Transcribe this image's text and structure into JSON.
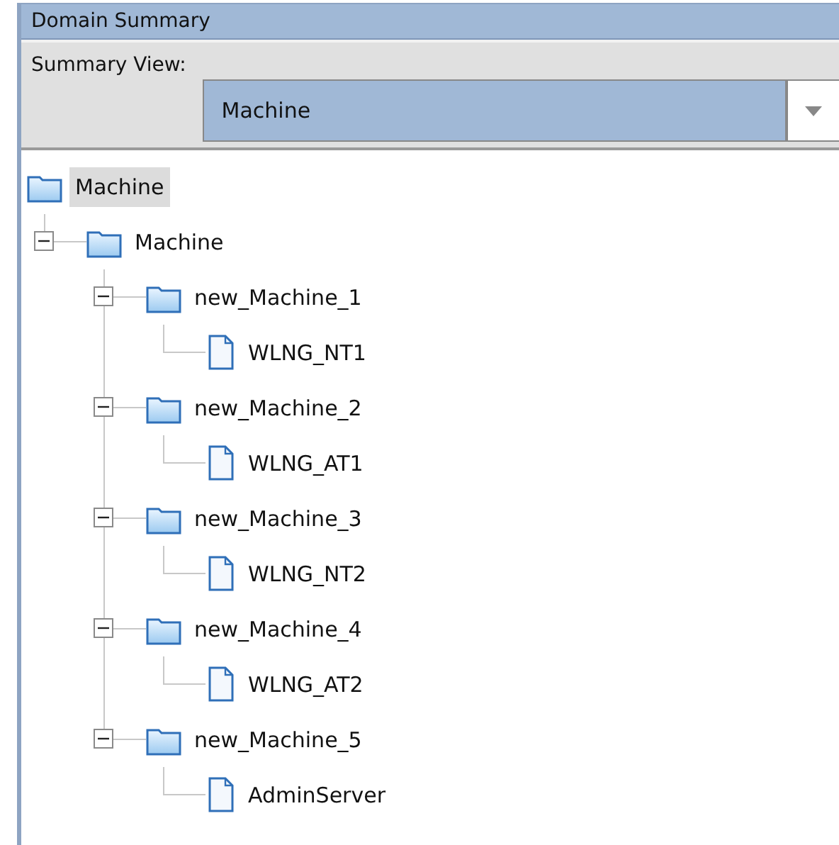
{
  "panel": {
    "title": "Domain Summary"
  },
  "summary_view": {
    "label": "Summary View:",
    "value": "Machine"
  },
  "tree": [
    {
      "label": "Machine",
      "kind": "folder",
      "selected": true,
      "children": [
        {
          "label": "Machine",
          "kind": "folder",
          "selected": false,
          "expanded": true,
          "children": [
            {
              "label": "new_Machine_1",
              "kind": "folder",
              "selected": false,
              "expanded": true,
              "children": [
                {
                  "label": "WLNG_NT1",
                  "kind": "file",
                  "selected": false
                }
              ]
            },
            {
              "label": "new_Machine_2",
              "kind": "folder",
              "selected": false,
              "expanded": true,
              "children": [
                {
                  "label": "WLNG_AT1",
                  "kind": "file",
                  "selected": false
                }
              ]
            },
            {
              "label": "new_Machine_3",
              "kind": "folder",
              "selected": false,
              "expanded": true,
              "children": [
                {
                  "label": "WLNG_NT2",
                  "kind": "file",
                  "selected": false
                }
              ]
            },
            {
              "label": "new_Machine_4",
              "kind": "folder",
              "selected": false,
              "expanded": true,
              "children": [
                {
                  "label": "WLNG_AT2",
                  "kind": "file",
                  "selected": false
                }
              ]
            },
            {
              "label": "new_Machine_5",
              "kind": "folder",
              "selected": false,
              "expanded": true,
              "children": [
                {
                  "label": "AdminServer",
                  "kind": "file",
                  "selected": false
                }
              ]
            }
          ]
        }
      ]
    }
  ]
}
